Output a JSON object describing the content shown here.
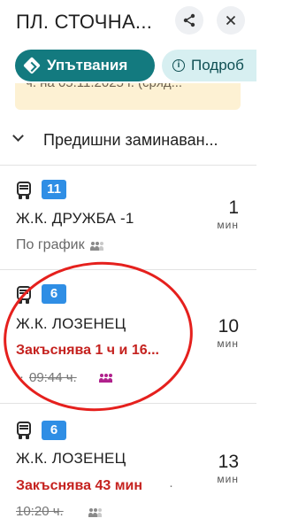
{
  "header": {
    "title": "ПЛ. СТОЧНА...",
    "share_icon": "share-icon",
    "close_icon": "close-icon"
  },
  "chips": {
    "directions_label": "Упътвания",
    "details_label": "Подроб",
    "accent_color": "#137a7f",
    "info_color": "#d7eff1"
  },
  "notice": {
    "text": "ч. на 05.11.2025 г. (сряд..."
  },
  "previous": {
    "label": "Предишни заминаван..."
  },
  "departures": [
    {
      "route": "11",
      "destination": "Ж.К. ДРУЖБА -1",
      "status": "По график",
      "status_type": "scheduled",
      "old_time": "",
      "minutes": "1",
      "minutes_unit": "мин"
    },
    {
      "route": "6",
      "destination": "Ж.К. ЛОЗЕНЕЦ",
      "status": "Закъснява 1 ч и 16...",
      "status_type": "delayed",
      "old_time": "09:44 ч.",
      "minutes": "10",
      "minutes_unit": "мин"
    },
    {
      "route": "6",
      "destination": "Ж.К. ЛОЗЕНЕЦ",
      "status": "Закъснява 43 мин",
      "status_type": "delayed",
      "old_time": "10:20 ч.",
      "minutes": "13",
      "minutes_unit": "мин"
    }
  ],
  "colors": {
    "route_badge": "#2f8ee5",
    "delay_text": "#c5221f",
    "annotation": "#e5201d"
  }
}
